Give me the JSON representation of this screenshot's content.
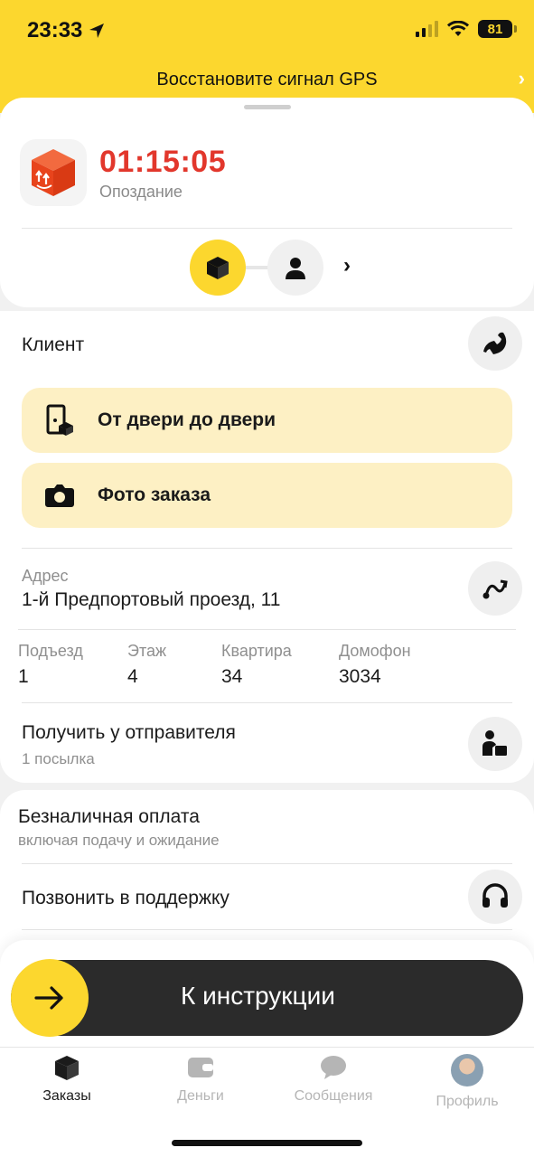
{
  "status_bar": {
    "time": "23:33",
    "battery": "81"
  },
  "gps_banner": {
    "text": "Восстановите сигнал GPS"
  },
  "order_header": {
    "timer": "01:15:05",
    "status": "Опоздание"
  },
  "client": {
    "label": "Клиент"
  },
  "actions": {
    "door_to_door": "От двери до двери",
    "order_photo": "Фото заказа"
  },
  "address": {
    "label": "Адрес",
    "value": "1-й Предпортовый проезд, 11"
  },
  "details": [
    {
      "label": "Подъезд",
      "value": "1"
    },
    {
      "label": "Этаж",
      "value": "4"
    },
    {
      "label": "Квартира",
      "value": "34"
    },
    {
      "label": "Домофон",
      "value": "3034"
    }
  ],
  "pickup": {
    "title": "Получить у отправителя",
    "subtitle": "1 посылка"
  },
  "payment": {
    "title": "Безналичная оплата",
    "subtitle": "включая подачу и ожидание"
  },
  "support": {
    "label": "Позвонить в поддержку"
  },
  "cta": {
    "label": "К инструкции"
  },
  "tabs": [
    {
      "label": "Заказы",
      "icon": "box-icon",
      "active": true
    },
    {
      "label": "Деньги",
      "icon": "wallet-icon",
      "active": false
    },
    {
      "label": "Сообщения",
      "icon": "chat-icon",
      "active": false
    },
    {
      "label": "Профиль",
      "icon": "avatar",
      "active": false
    }
  ],
  "colors": {
    "accent": "#fcd72e",
    "late": "#e2372c",
    "box": "#ef4a23",
    "action_bg": "#fdf0c4"
  }
}
